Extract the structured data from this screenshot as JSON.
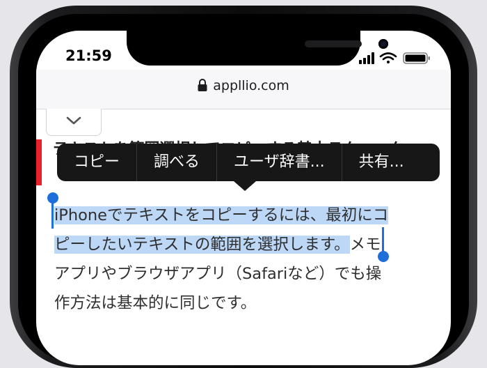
{
  "status_bar": {
    "time": "21:59"
  },
  "browser": {
    "url": "appllio.com"
  },
  "article": {
    "heading": "テキストを範囲選択してコピーする基本テクニック",
    "paragraph": {
      "line1_selected": "iPhoneでテキストをコピーするには、最初にコ",
      "line2_selected": "ピーしたいテキストの範囲を選択します。",
      "line2_rest": "メモ",
      "line3": "アプリやブラウザアプリ（Safariなど）でも操",
      "line4": "作方法は基本的に同じです。"
    }
  },
  "edit_menu": {
    "items": [
      "コピー",
      "調べる",
      "ユーザ辞書...",
      "共有..."
    ]
  },
  "icons": {
    "lock": "lock-icon",
    "signal": "signal-icon",
    "wifi": "wifi-icon",
    "battery": "battery-icon",
    "collapse": "chevron-down-icon"
  },
  "colors": {
    "selection": "#bcd8f6",
    "handle": "#1e6fd9",
    "accent_bar": "#e7222c",
    "menu": "#171717"
  }
}
